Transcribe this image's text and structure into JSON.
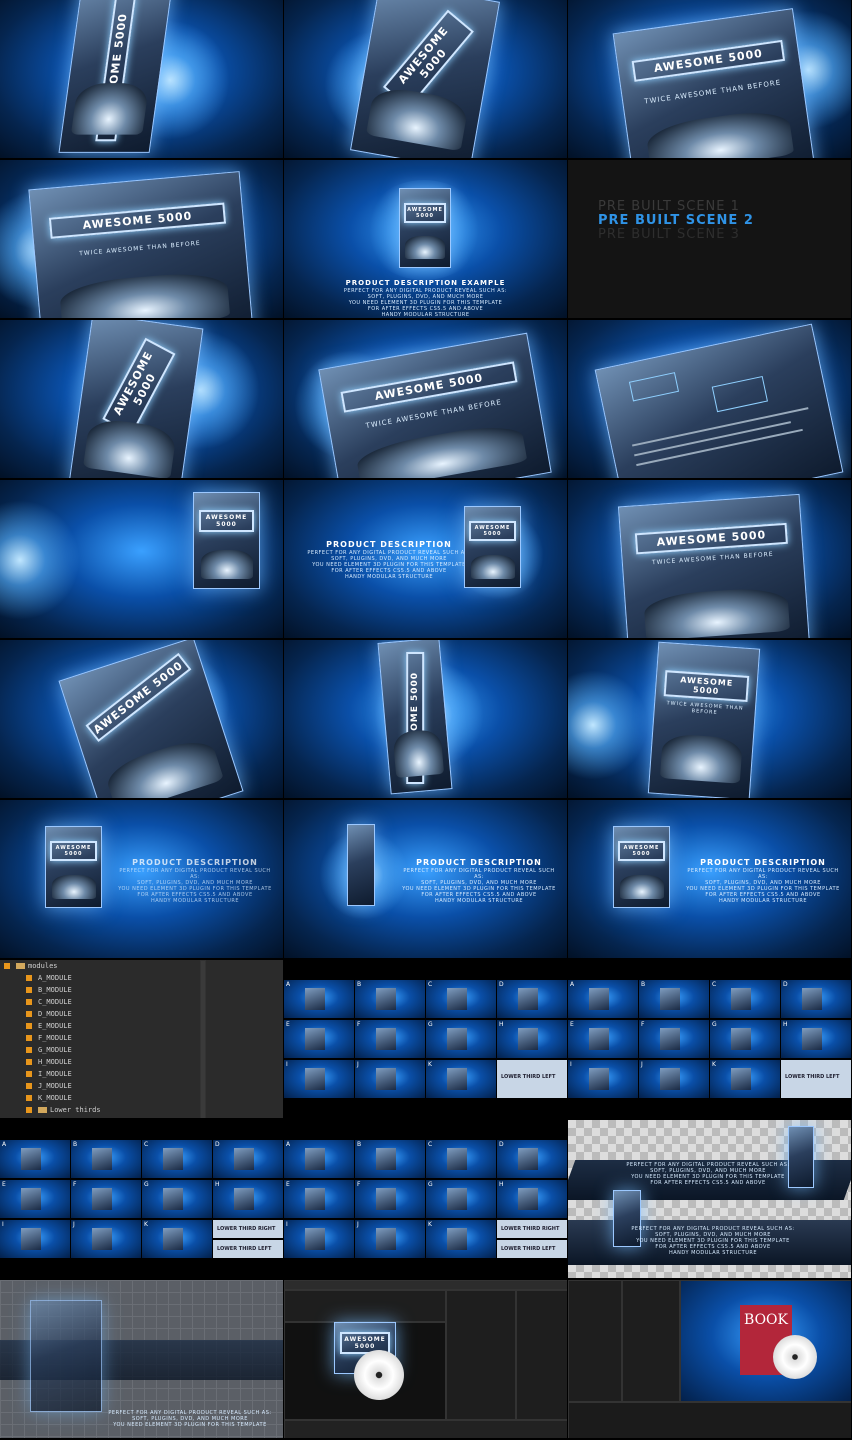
{
  "product": {
    "title": "AWESOME 5000",
    "tagline": "TWICE AWESOME THAN BEFORE"
  },
  "description": {
    "heading": "PRODUCT DESCRIPTION",
    "example_heading": "PRODUCT DESCRIPTION EXAMPLE",
    "lines": [
      "PERFECT FOR ANY DIGITAL PRODUCT REVEAL SUCH AS:",
      "SOFT, PLUGINS, DVD, AND MUCH MORE",
      "YOU NEED ELEMENT 3D PLUGIN FOR THIS TEMPLATE",
      "FOR AFTER EFFECTS CS5.5 AND ABOVE",
      "HANDY MODULAR STRUCTURE"
    ]
  },
  "scenes": [
    "PRE BUILT SCENE 1",
    "PRE BUILT SCENE 2",
    "PRE BUILT SCENE 3"
  ],
  "project": {
    "root_folder": "modules",
    "modules": [
      "A_MODULE",
      "B_MODULE",
      "C_MODULE",
      "D_MODULE",
      "E_MODULE",
      "F_MODULE",
      "G_MODULE",
      "H_MODULE",
      "I_MODULE",
      "J_MODULE",
      "K_MODULE"
    ],
    "subfolder": "Lower thirds"
  },
  "mosaic": {
    "letters": [
      "A",
      "B",
      "C",
      "D",
      "E",
      "F",
      "G",
      "H",
      "I",
      "J",
      "K"
    ],
    "lower_third_left": "LOWER THIRD LEFT",
    "lower_third_right": "LOWER THIRD RIGHT"
  },
  "book_label": "BOOK",
  "colors": {
    "accent_blue": "#2f93e6",
    "module_orange": "#e8961c"
  }
}
